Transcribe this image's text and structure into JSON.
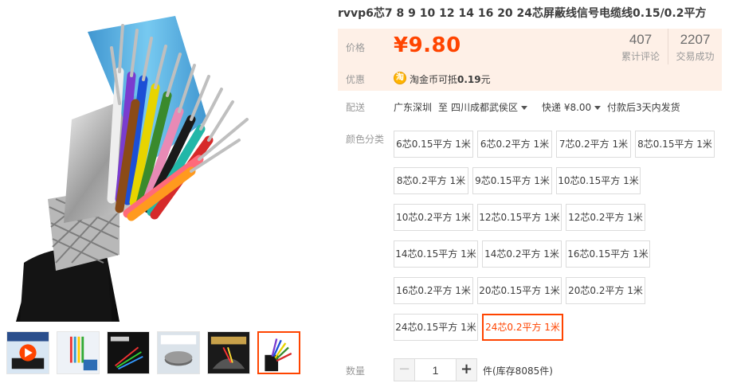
{
  "product": {
    "title": "rvvp6芯7 8 9 10 12 14 16 20 24芯屏蔽线信号电缆线0.15/0.2平方",
    "image_alt": "multi-core shielded cable",
    "colors": {
      "accent": "#ff4400",
      "price_bg": "#fef0e7"
    }
  },
  "price": {
    "label": "价格",
    "value": "¥9.80",
    "stats": [
      {
        "num": "407",
        "label": "累计评论"
      },
      {
        "num": "2207",
        "label": "交易成功"
      }
    ]
  },
  "promo": {
    "label": "优惠",
    "icon": "taobao-coin-icon",
    "icon_char": "淘",
    "text_prefix": "淘金币可抵",
    "amount": "0.19",
    "text_suffix": "元"
  },
  "delivery": {
    "label": "配送",
    "from": "广东深圳",
    "to_word": "至",
    "destination": "四川成都武侯区",
    "shipping": "快递 ¥8.00",
    "note": "付款后3天内发货"
  },
  "sku": {
    "label": "颜色分类",
    "options": [
      "6芯0.15平方 1米",
      "6芯0.2平方 1米",
      "7芯0.2平方 1米",
      "8芯0.15平方 1米",
      "8芯0.2平方 1米",
      "9芯0.15平方 1米",
      "10芯0.15平方 1米",
      "10芯0.2平方 1米",
      "12芯0.15平方 1米",
      "12芯0.2平方 1米",
      "14芯0.15平方 1米",
      "14芯0.2平方 1米",
      "16芯0.15平方 1米",
      "16芯0.2平方 1米",
      "20芯0.15平方 1米",
      "20芯0.2平方 1米",
      "24芯0.15平方 1米",
      "24芯0.2平方 1米"
    ],
    "selected": "24芯0.2平方 1米"
  },
  "quantity": {
    "label": "数量",
    "value": "1",
    "minus": "−",
    "plus": "+",
    "stock": "件(库存8085件)"
  },
  "thumbnails": [
    {
      "name": "thumb-1",
      "icon": "play-video-icon"
    },
    {
      "name": "thumb-2"
    },
    {
      "name": "thumb-3"
    },
    {
      "name": "thumb-4"
    },
    {
      "name": "thumb-5"
    },
    {
      "name": "thumb-6",
      "active": true
    }
  ]
}
